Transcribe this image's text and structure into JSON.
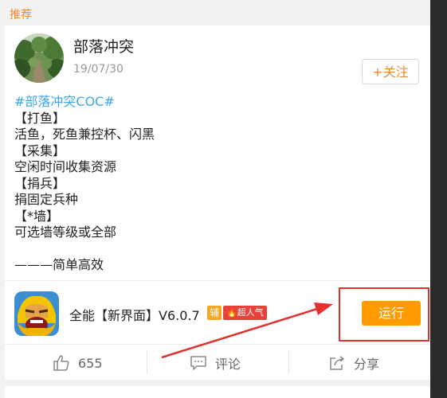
{
  "section": {
    "title": "推荐"
  },
  "post": {
    "user_name": "部落冲突",
    "date": "19/07/30",
    "follow_label": "+关注",
    "lines": [
      "#部落冲突COC#",
      "【打鱼】",
      "活鱼，死鱼兼控杯、闪黑",
      "【采集】",
      "空闲时间收集资源",
      "【捐兵】",
      "捐固定兵种",
      "【*墙】",
      "可选墙等级或全部",
      "",
      "———简单高效"
    ]
  },
  "app": {
    "name": "全能【新界面】V6.0.7",
    "assist_badge": "辅",
    "hot_badge": "超人气",
    "run_label": "运行",
    "icon": "clash-of-clans-barbarian-icon"
  },
  "actions": {
    "like_count": "655",
    "comment_label": "评论",
    "share_label": "分享"
  },
  "annotation": {
    "color": "#e2312e"
  }
}
